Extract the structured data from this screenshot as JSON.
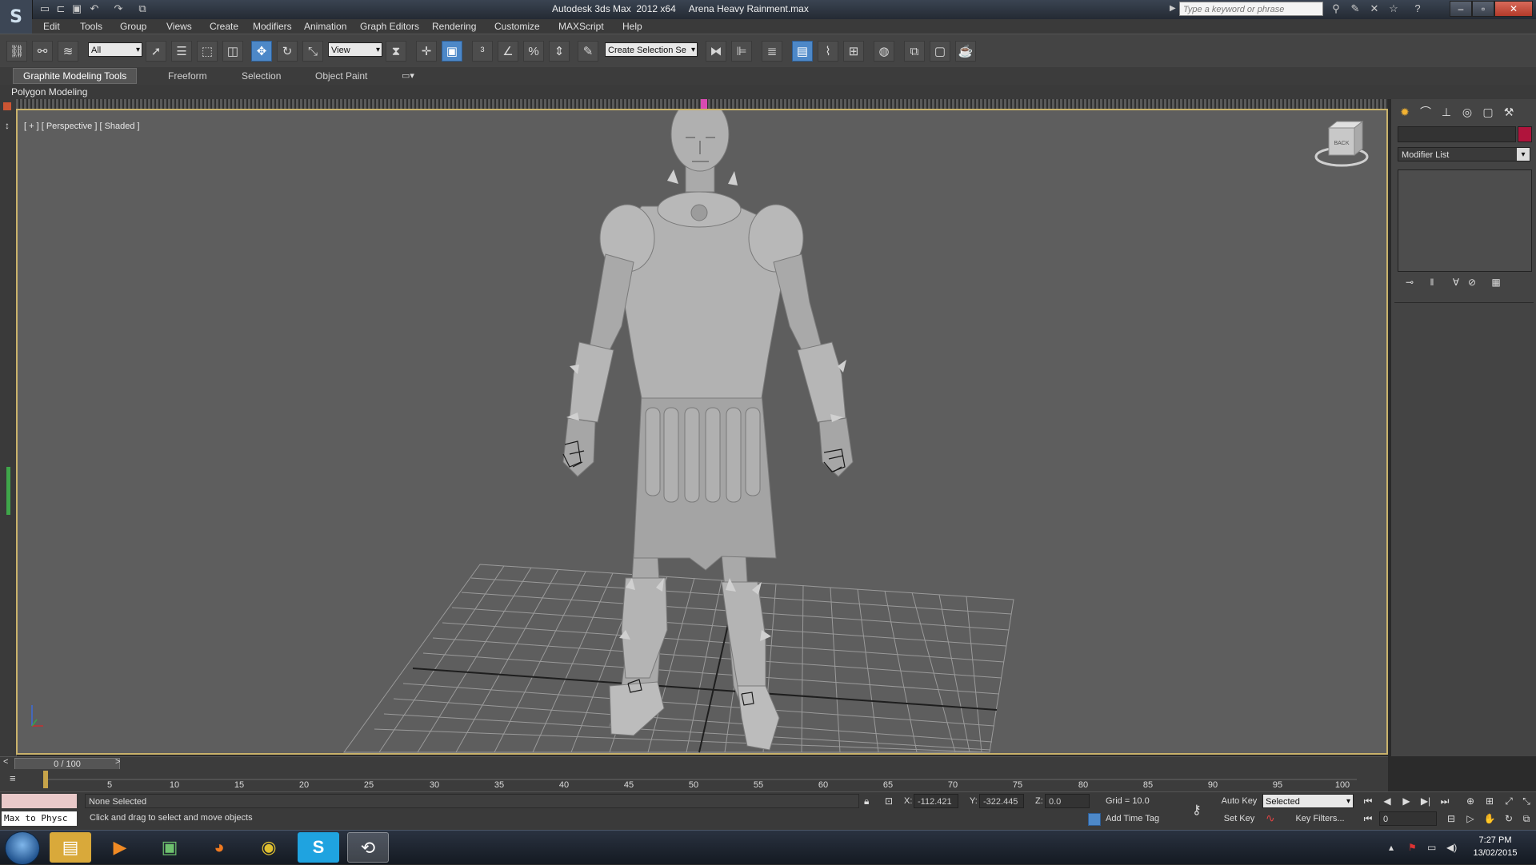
{
  "window": {
    "title": "Autodesk 3ds Max  2012 x64     Arena Heavy Rainment.max",
    "search_placeholder": "Type a keyword or phrase",
    "app_logo": "S",
    "quick_access_icons": [
      "new-icon",
      "open-icon",
      "save-icon",
      "undo-icon",
      "redo-icon",
      "project-folder-icon"
    ]
  },
  "menu": {
    "items": [
      "Edit",
      "Tools",
      "Group",
      "Views",
      "Create",
      "Modifiers",
      "Animation",
      "Graph Editors",
      "Rendering",
      "Customize",
      "MAXScript",
      "Help"
    ]
  },
  "toolbar": {
    "selection_filter": "All",
    "reference_coord": "View",
    "named_selection": "Create Selection Se",
    "active_tool": "select-and-move"
  },
  "ribbon": {
    "tabs": [
      "Graphite Modeling Tools",
      "Freeform",
      "Selection",
      "Object Paint"
    ],
    "active_tab": "Graphite Modeling Tools",
    "panel_label": "Polygon Modeling"
  },
  "viewport": {
    "label": "[ + ] [ Perspective ] [ Shaded ]",
    "viewcube_label": "BACK",
    "shading": "Shaded",
    "view": "Perspective"
  },
  "command_panel": {
    "modifier_list": "Modifier List",
    "object_color": "#b0143c"
  },
  "timeline": {
    "current": "0 / 100",
    "ticks": [
      "5",
      "10",
      "15",
      "20",
      "25",
      "30",
      "35",
      "40",
      "45",
      "50",
      "55",
      "60",
      "65",
      "70",
      "75",
      "80",
      "85",
      "90",
      "95",
      "100"
    ]
  },
  "status": {
    "maxscript_label": "Max to Physc",
    "selection": "None Selected",
    "prompt": "Click and drag to select and move objects",
    "x_label": "X:",
    "x_value": "-112.421",
    "y_label": "Y:",
    "y_value": "-322.445",
    "z_label": "Z:",
    "z_value": "0.0",
    "grid": "Grid = 10.0",
    "add_time_tag": "Add Time Tag",
    "auto_key": "Auto Key",
    "set_key": "Set Key",
    "key_mode": "Selected",
    "key_filters": "Key Filters...",
    "current_frame": "0"
  },
  "taskbar": {
    "apps": [
      "explorer",
      "media-player",
      "remote-desktop",
      "firefox",
      "chrome",
      "skype",
      "3ds-max"
    ],
    "time": "7:27 PM",
    "date": "13/02/2015"
  },
  "colors": {
    "viewport_border": "#c9b26b",
    "active_button": "#4d88c8",
    "viewport_bg": "#5e5e5e"
  }
}
